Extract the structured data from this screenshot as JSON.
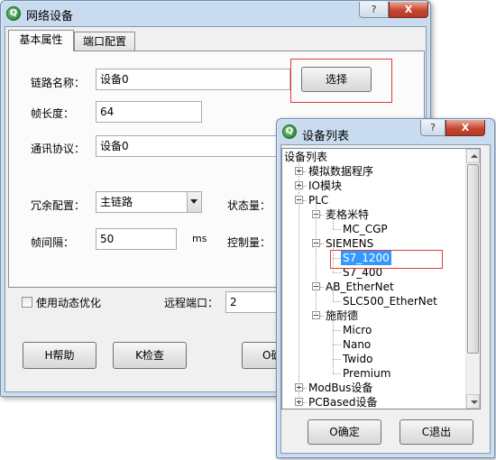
{
  "network_window": {
    "title": "网络设备",
    "help_glyph": "?",
    "close_glyph": "X",
    "tabs": [
      {
        "label": "基本属性",
        "active": true
      },
      {
        "label": "端口配置",
        "active": false
      }
    ],
    "fields": {
      "link_name_label": "链路名称：",
      "link_name_value": "设备0",
      "select_button": "选择",
      "frame_length_label": "帧长度：",
      "frame_length_value": "64",
      "protocol_label": "通讯协议：",
      "protocol_value": "设备0",
      "redundancy_label": "冗余配置：",
      "redundancy_value": "主链路",
      "status_label": "状态量：",
      "interval_label": "帧间隔：",
      "interval_value": "50",
      "interval_unit": "ms",
      "control_label": "控制量：",
      "dynamic_opt_label": "使用动态优化",
      "dynamic_opt_checked": false,
      "remote_port_label": "远程端口：",
      "remote_port_value": "2"
    },
    "buttons": {
      "help": "H帮助",
      "check": "K检查",
      "ok_partial": "O确"
    }
  },
  "device_list_window": {
    "title": "设备列表",
    "help_glyph": "?",
    "close_glyph": "X",
    "tree": {
      "root": "设备列表",
      "items": [
        {
          "label": "模拟数据程序",
          "level": 1,
          "expander": "plus"
        },
        {
          "label": "IO模块",
          "level": 1,
          "expander": "plus"
        },
        {
          "label": "PLC",
          "level": 1,
          "expander": "minus"
        },
        {
          "label": "麦格米特",
          "level": 2,
          "expander": "minus"
        },
        {
          "label": "MC_CGP",
          "level": 3,
          "expander": ""
        },
        {
          "label": "SIEMENS",
          "level": 2,
          "expander": "minus"
        },
        {
          "label": "S7_1200",
          "level": 3,
          "expander": "",
          "selected": true
        },
        {
          "label": "S7_400",
          "level": 3,
          "expander": ""
        },
        {
          "label": "AB_EtherNet",
          "level": 2,
          "expander": "minus"
        },
        {
          "label": "SLC500_EtherNet",
          "level": 3,
          "expander": ""
        },
        {
          "label": "施耐德",
          "level": 2,
          "expander": "minus"
        },
        {
          "label": "Micro",
          "level": 3,
          "expander": ""
        },
        {
          "label": "Nano",
          "level": 3,
          "expander": ""
        },
        {
          "label": "Twido",
          "level": 3,
          "expander": ""
        },
        {
          "label": "Premium",
          "level": 3,
          "expander": ""
        },
        {
          "label": "ModBus设备",
          "level": 1,
          "expander": "plus"
        },
        {
          "label": "PCBased设备",
          "level": 1,
          "expander": "plus"
        }
      ]
    },
    "buttons": {
      "ok": "O确定",
      "exit": "C退出"
    }
  },
  "colors": {
    "selection": "#3399ff",
    "highlight_box": "#e0393d",
    "window_frame": "#c9dcef"
  }
}
